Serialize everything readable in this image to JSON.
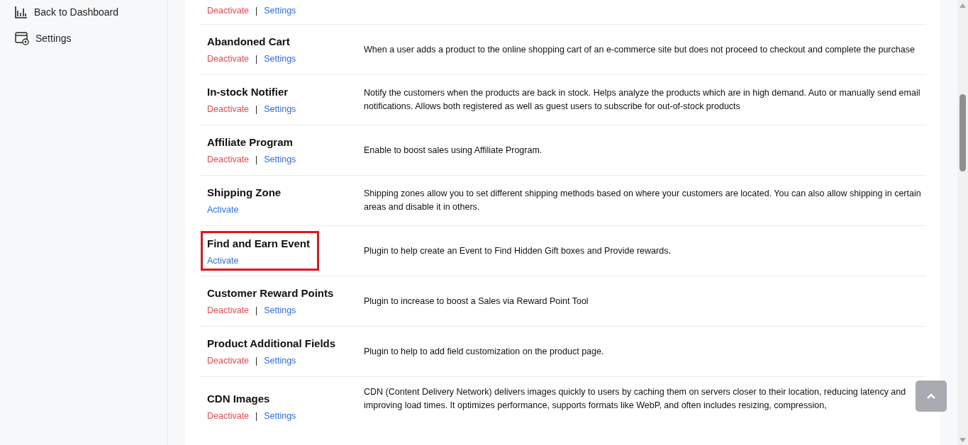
{
  "sidebar": {
    "items": [
      {
        "label": "Back to Dashboard",
        "kind": "chart"
      },
      {
        "label": "Settings",
        "kind": "settings"
      }
    ]
  },
  "plugins": [
    {
      "highlighted": false,
      "actions": [
        {
          "kind": "deactivate",
          "label": "Deactivate"
        },
        {
          "kind": "separator",
          "label": "|"
        },
        {
          "kind": "settings",
          "label": "Settings"
        }
      ]
    },
    {
      "title": "Abandoned Cart",
      "highlighted": false,
      "actions": [
        {
          "kind": "deactivate",
          "label": "Deactivate"
        },
        {
          "kind": "separator",
          "label": "|"
        },
        {
          "kind": "settings",
          "label": "Settings"
        }
      ],
      "description": "When a user adds a product to the online shopping cart of an e-commerce site but does not proceed to checkout and complete the purchase"
    },
    {
      "title": "In-stock Notifier",
      "highlighted": false,
      "actions": [
        {
          "kind": "deactivate",
          "label": "Deactivate"
        },
        {
          "kind": "separator",
          "label": "|"
        },
        {
          "kind": "settings",
          "label": "Settings"
        }
      ],
      "description": "Notify the customers when the products are back in stock. Helps analyze the products which are in high demand. Auto or manually send email notifications. Allows both registered as well as guest users to subscribe for out-of-stock products"
    },
    {
      "title": "Affiliate Program",
      "highlighted": false,
      "actions": [
        {
          "kind": "deactivate",
          "label": "Deactivate"
        },
        {
          "kind": "separator",
          "label": "|"
        },
        {
          "kind": "settings",
          "label": "Settings"
        }
      ],
      "description": "Enable to boost sales using Affiliate Program."
    },
    {
      "title": "Shipping Zone",
      "highlighted": false,
      "actions": [
        {
          "kind": "activate",
          "label": "Activate"
        }
      ],
      "description": "Shipping zones allow you to set different shipping methods based on where your customers are located. You can also allow shipping in certain areas and disable it in others."
    },
    {
      "title": "Find and Earn Event",
      "highlighted": true,
      "actions": [
        {
          "kind": "activate",
          "label": "Activate"
        }
      ],
      "description": "Plugin to help create an Event to Find Hidden Gift boxes and Provide rewards."
    },
    {
      "title": "Customer Reward Points",
      "highlighted": false,
      "actions": [
        {
          "kind": "deactivate",
          "label": "Deactivate"
        },
        {
          "kind": "separator",
          "label": "|"
        },
        {
          "kind": "settings",
          "label": "Settings"
        }
      ],
      "description": "Plugin to increase to boost a Sales via Reward Point Tool"
    },
    {
      "title": "Product Additional Fields",
      "highlighted": false,
      "actions": [
        {
          "kind": "deactivate",
          "label": "Deactivate"
        },
        {
          "kind": "separator",
          "label": "|"
        },
        {
          "kind": "settings",
          "label": "Settings"
        }
      ],
      "description": "Plugin to help to add field customization on the product page."
    },
    {
      "title": "CDN Images",
      "highlighted": false,
      "actions": [
        {
          "kind": "deactivate",
          "label": "Deactivate"
        },
        {
          "kind": "separator",
          "label": "|"
        },
        {
          "kind": "settings",
          "label": "Settings"
        }
      ],
      "description": "CDN (Content Delivery Network) delivers images quickly to users by caching them on servers closer to their location, reducing latency and improving load times. It optimizes performance, supports formats like WebP, and often includes resizing, compression,"
    }
  ]
}
